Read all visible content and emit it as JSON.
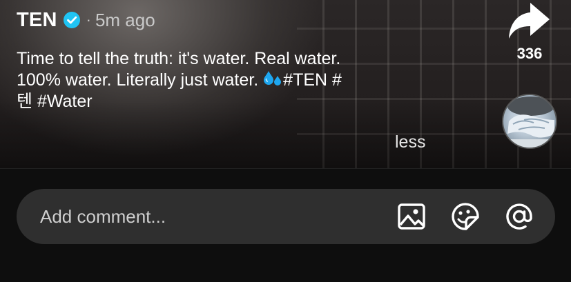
{
  "post": {
    "username": "TEN",
    "separator": "·",
    "time_ago": "5m ago",
    "caption_lines": [
      "Time to tell the truth: it's water. Real water.",
      "100% water. Literally just water.",
      "텐 #Water"
    ],
    "caption_hashtags_line2": "#TEN #",
    "less_label": "less"
  },
  "actions": {
    "share_count": "336"
  },
  "comment": {
    "placeholder": "Add comment..."
  },
  "icons": {
    "verified": "verified-badge-icon",
    "share": "share-arrow-icon",
    "emoji": "water-drops-emoji",
    "image": "image-icon",
    "sticker": "sticker-icon",
    "mention": "mention-at-icon"
  },
  "colors": {
    "verified_blue": "#20c4f4",
    "comment_bar_bg": "#2f2f2f",
    "emoji_blue": "#1ea7f0"
  }
}
